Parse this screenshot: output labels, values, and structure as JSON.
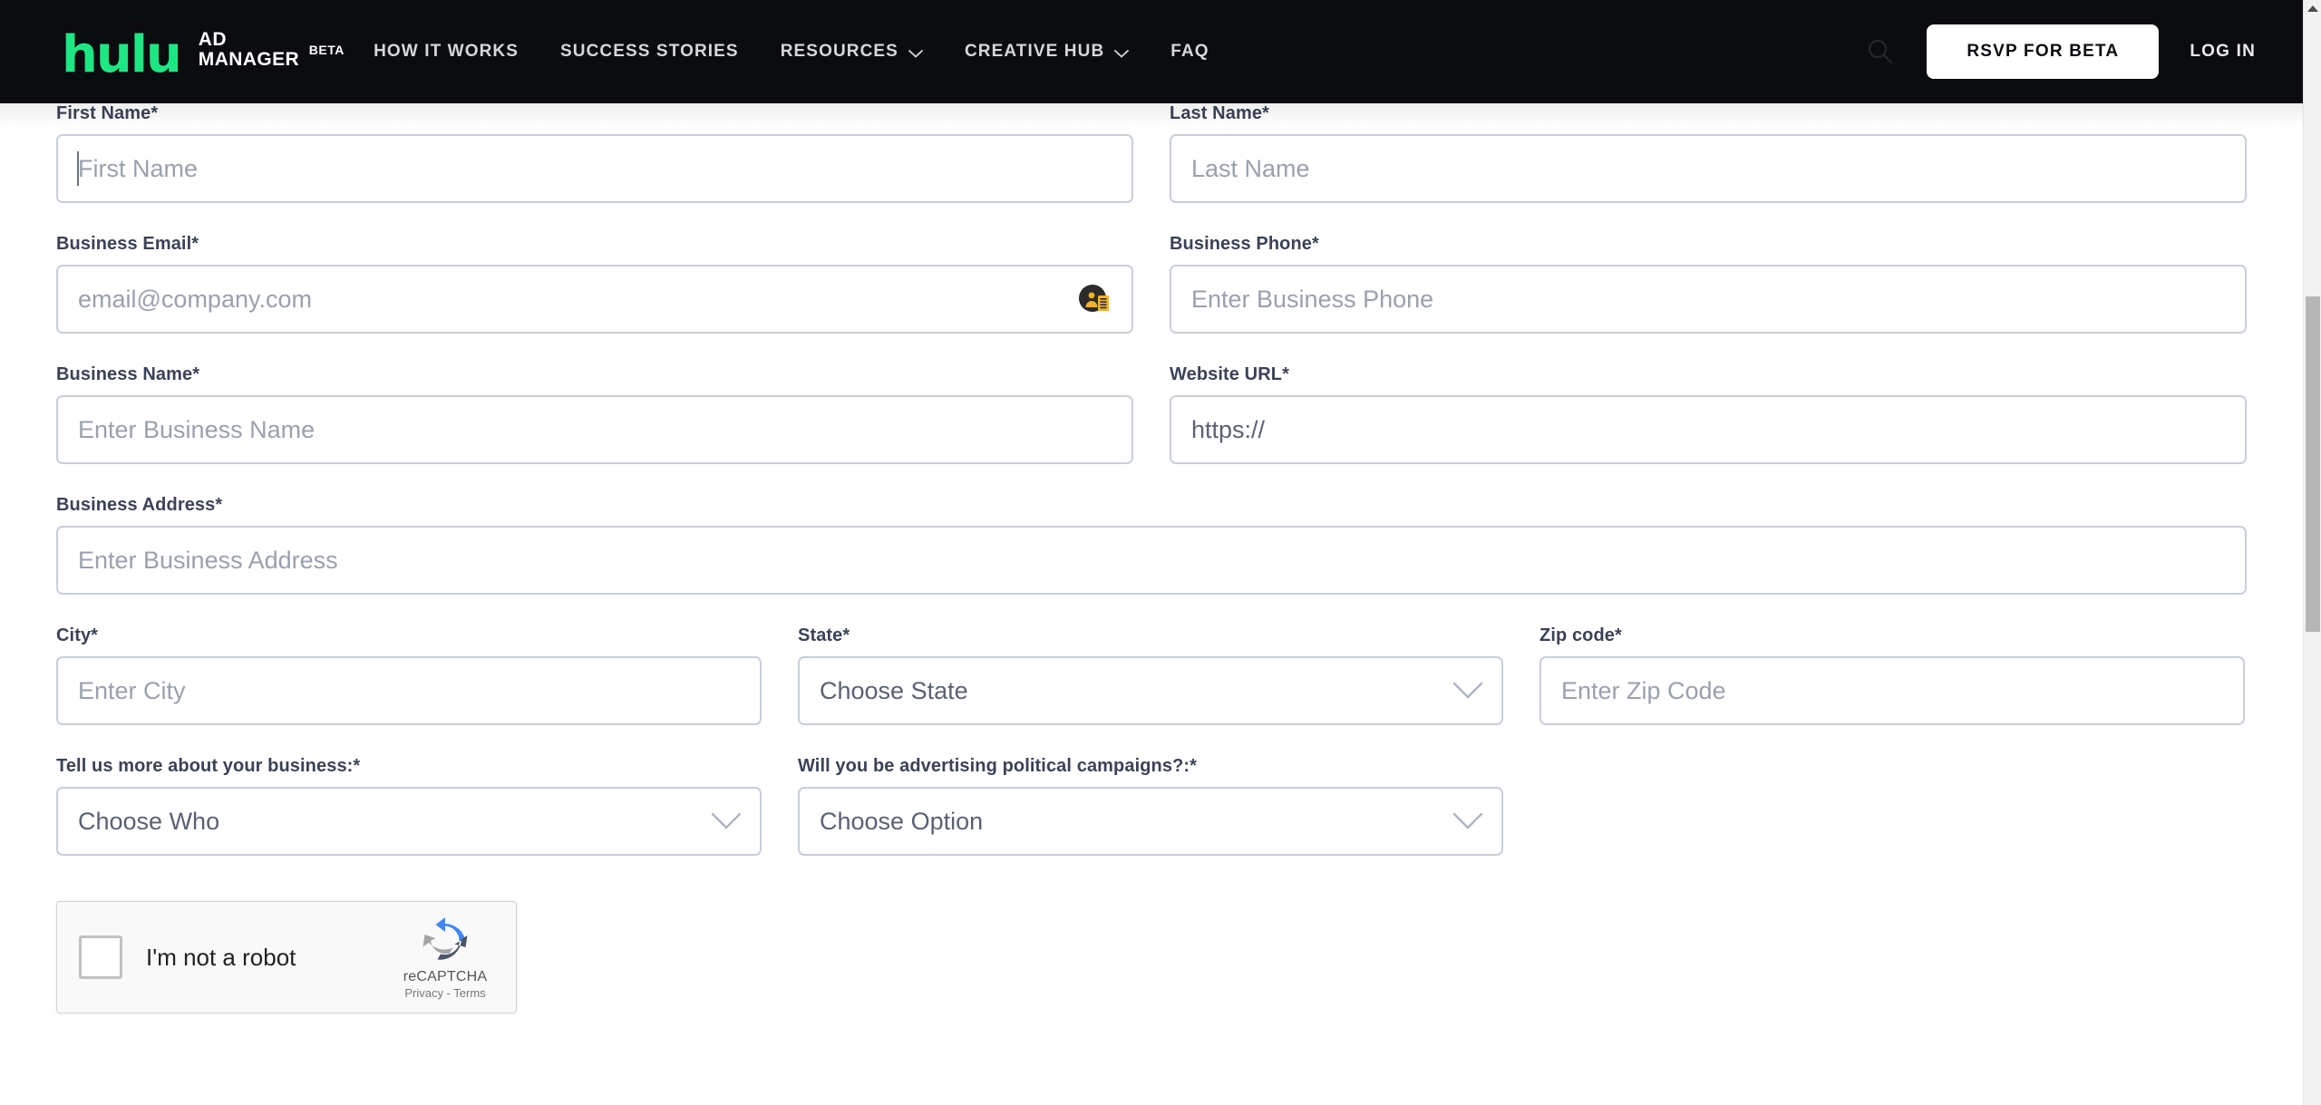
{
  "nav": {
    "brand": {
      "wordmark": "hulu",
      "line1": "AD",
      "line2": "MANAGER",
      "beta": "BETA"
    },
    "links": [
      {
        "label": "HOW IT WORKS",
        "has_dropdown": false
      },
      {
        "label": "SUCCESS STORIES",
        "has_dropdown": false
      },
      {
        "label": "RESOURCES",
        "has_dropdown": true
      },
      {
        "label": "CREATIVE HUB",
        "has_dropdown": true
      },
      {
        "label": "FAQ",
        "has_dropdown": false
      }
    ],
    "search_icon": "search-icon",
    "rsvp_button": "RSVP FOR BETA",
    "login": "LOG IN",
    "background_color": "#0b0c10",
    "accent_color": "#1ce783"
  },
  "form": {
    "first_name": {
      "label": "First Name*",
      "placeholder": "First Name",
      "value": ""
    },
    "last_name": {
      "label": "Last Name*",
      "placeholder": "Last Name",
      "value": ""
    },
    "business_email": {
      "label": "Business Email*",
      "placeholder": "email@company.com",
      "value": "",
      "icon": "password-manager-autofill-icon"
    },
    "business_phone": {
      "label": "Business Phone*",
      "placeholder": "Enter Business Phone",
      "value": ""
    },
    "business_name": {
      "label": "Business Name*",
      "placeholder": "Enter Business Name",
      "value": ""
    },
    "website_url": {
      "label": "Website URL*",
      "placeholder": "https://",
      "value": ""
    },
    "business_address": {
      "label": "Business Address*",
      "placeholder": "Enter Business Address",
      "value": ""
    },
    "city": {
      "label": "City*",
      "placeholder": "Enter City",
      "value": ""
    },
    "state": {
      "label": "State*",
      "selected": "Choose State"
    },
    "zip_code": {
      "label": "Zip code*",
      "placeholder": "Enter Zip Code",
      "value": ""
    },
    "business_type": {
      "label": "Tell us more about your business:*",
      "selected": "Choose Who"
    },
    "political_campaigns": {
      "label": "Will you be advertising political campaigns?:*",
      "selected": "Choose Option"
    }
  },
  "recaptcha": {
    "label": "I'm not a robot",
    "brand_name": "reCAPTCHA",
    "fine_print": "Privacy - Terms",
    "checked": false
  }
}
